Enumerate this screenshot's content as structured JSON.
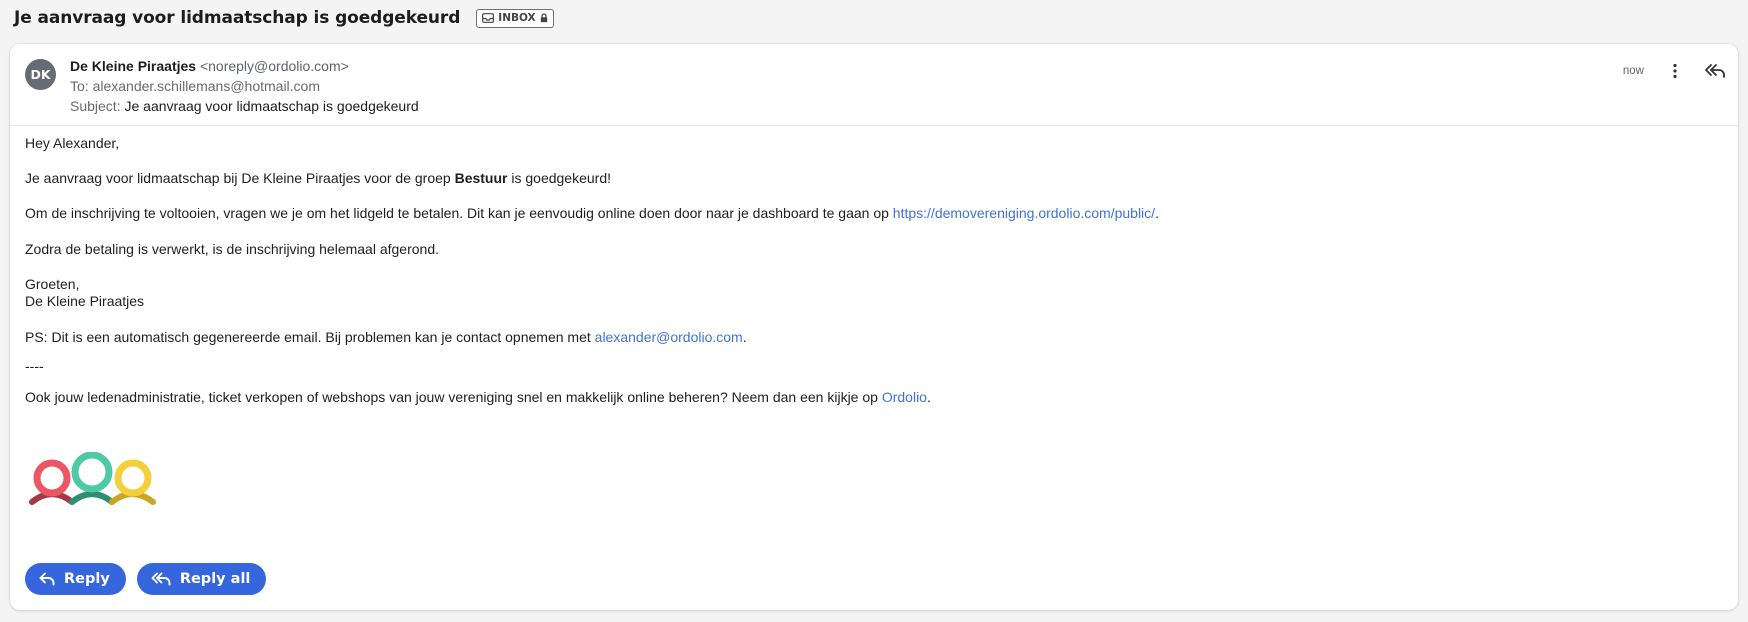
{
  "header": {
    "subject": "Je aanvraag voor lidmaatschap is goedgekeurd",
    "badge": "INBOX"
  },
  "message": {
    "avatar_initials": "DK",
    "from_name": "De Kleine Piraatjes",
    "from_email": "<noreply@ordolio.com>",
    "to_label": "To:",
    "to_email": "alexander.schillemans@hotmail.com",
    "subject_label": "Subject:",
    "subject": "Je aanvraag voor lidmaatschap is goedgekeurd",
    "time": "now"
  },
  "body": {
    "greeting": "Hey Alexander,",
    "p1_a": "Je aanvraag voor lidmaatschap bij De Kleine Piraatjes voor de groep ",
    "p1_bold": "Bestuur",
    "p1_b": " is goedgekeurd!",
    "p2_a": "Om de inschrijving te voltooien, vragen we je om het lidgeld te betalen. Dit kan je eenvoudig online doen door naar je dashboard te gaan op ",
    "p2_link": "https://demovereniging.ordolio.com/public/",
    "p2_b": ".",
    "p3": "Zodra de betaling is verwerkt, is de inschrijving helemaal afgerond.",
    "closing": "Groeten,",
    "signature": "De Kleine Piraatjes",
    "ps_a": "PS: Dit is een automatisch gegenereerde email. Bij problemen kan je contact opnemen met ",
    "ps_link": "alexander@ordolio.com",
    "ps_b": ".",
    "divider": "----",
    "promo_a": "Ook jouw ledenadministratie, ticket verkopen of webshops van jouw vereniging snel en makkelijk online beheren? Neem dan een kijkje op ",
    "promo_link": "Ordolio",
    "promo_b": "."
  },
  "actions": {
    "reply": "Reply",
    "reply_all": "Reply all"
  },
  "colors": {
    "accent": "#3566dd",
    "link": "#3f73d6",
    "logo_red": "#ec5563",
    "logo_teal": "#4ec9a6",
    "logo_yellow": "#f2cf3b"
  },
  "icons": [
    "inbox-icon",
    "lock-icon",
    "more-vertical-icon",
    "reply-all-icon",
    "reply-icon",
    "ordolio-logo"
  ]
}
